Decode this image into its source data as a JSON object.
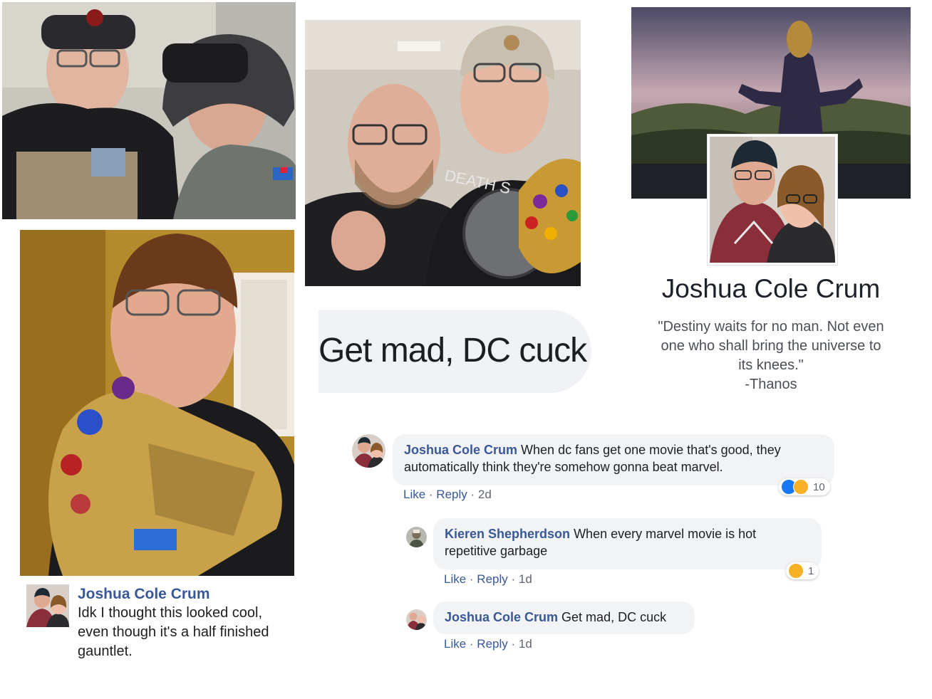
{
  "profile": {
    "name": "Joshua Cole Crum",
    "quote_lines": [
      "\"Destiny waits for no man. Not even",
      "one who shall bring the universe to",
      "its knees.\"",
      "-Thanos"
    ]
  },
  "zoom_comment": "Get mad, DC cuck",
  "comments": [
    {
      "author": "Joshua Cole Crum",
      "text": "When dc fans get one movie that's good, they automatically think they're somehow gonna beat marvel.",
      "like": "Like",
      "reply": "Reply",
      "time": "2d",
      "reaction_count": "10",
      "reactions": [
        "like-icon",
        "haha-icon"
      ]
    },
    {
      "author": "Kieren Shepherdson",
      "text": "When every marvel movie is hot repetitive garbage",
      "like": "Like",
      "reply": "Reply",
      "time": "1d",
      "reaction_count": "1",
      "reactions": [
        "haha-icon"
      ]
    },
    {
      "author": "Joshua Cole Crum",
      "text": "Get mad, DC cuck",
      "like": "Like",
      "reply": "Reply",
      "time": "1d"
    }
  ],
  "post": {
    "author": "Joshua Cole Crum",
    "text": "Idk I thought this looked cool, even though it's a half finished gauntlet."
  },
  "colors": {
    "link": "#385898",
    "bubble": "#f2f3f5",
    "like": "#1877f2",
    "haha": "#f7b125"
  }
}
